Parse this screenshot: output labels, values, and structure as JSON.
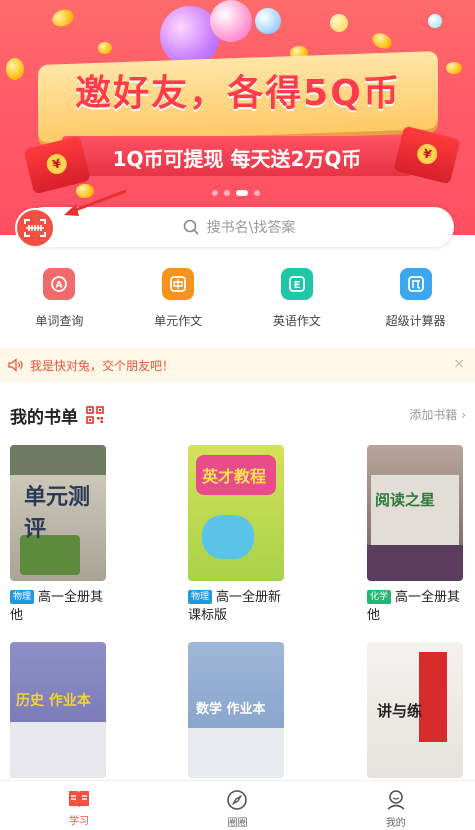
{
  "banner": {
    "title": "邀好友，各得5Q币",
    "subtitle": "1Q币可提现 每天送2万Q币",
    "envelope_mark": "¥"
  },
  "search": {
    "placeholder": "搜书名\\找答案"
  },
  "tools": [
    {
      "label": "单词查询",
      "icon": "word-lookup-icon",
      "color": "#f26a6a"
    },
    {
      "label": "单元作文",
      "icon": "unit-essay-icon",
      "color": "#f7931e"
    },
    {
      "label": "英语作文",
      "icon": "english-essay-icon",
      "color": "#1fc7a8"
    },
    {
      "label": "超级计算器",
      "icon": "calculator-icon",
      "color": "#3aa7f0"
    }
  ],
  "notice": {
    "text": "我是快对兔，交个朋友吧！",
    "close": "×"
  },
  "booklist": {
    "title": "我的书单",
    "add_label": "添加书籍 ›",
    "books": [
      {
        "tag": "物理",
        "tag_color": "#1e9be0",
        "name": "高一全册其他",
        "cover_text": "单元测评"
      },
      {
        "tag": "物理",
        "tag_color": "#1e9be0",
        "name": "高一全册新课标版",
        "cover_text": "英才教程"
      },
      {
        "tag": "化学",
        "tag_color": "#22b573",
        "name": "高一全册其他",
        "cover_text": "阅读之星"
      },
      {
        "tag": "",
        "tag_color": "",
        "name": "",
        "cover_text": "历史 作业本"
      },
      {
        "tag": "",
        "tag_color": "",
        "name": "",
        "cover_text": "数学 作业本"
      },
      {
        "tag": "",
        "tag_color": "",
        "name": "",
        "cover_text": "讲与练"
      }
    ]
  },
  "tabbar": {
    "tabs": [
      {
        "label": "学习",
        "active": true
      },
      {
        "label": "圈圈",
        "active": false
      },
      {
        "label": "我的",
        "active": false
      }
    ],
    "accent": "#f25042"
  }
}
